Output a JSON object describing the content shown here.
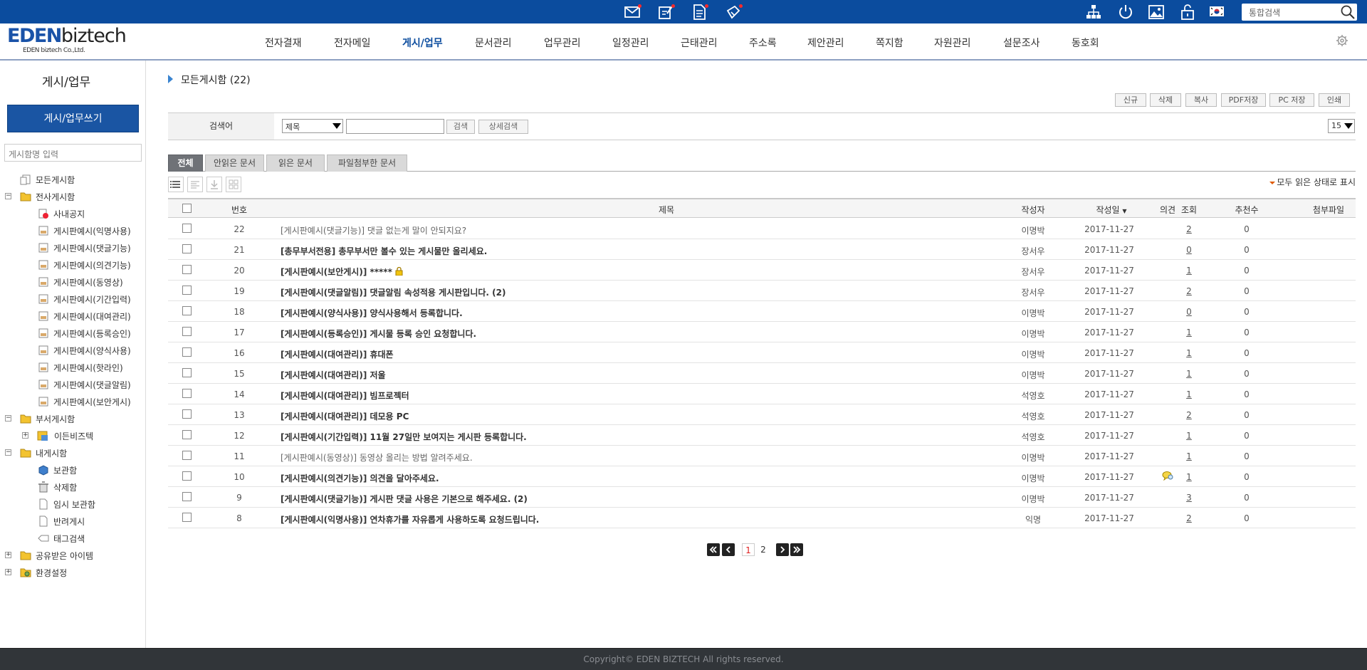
{
  "topbar": {
    "search_placeholder": "통합검색",
    "icons": [
      "mail-icon",
      "approval-icon",
      "document-icon",
      "share-icon",
      "org-chart-icon",
      "power-icon",
      "image-icon",
      "lock-icon",
      "korea-flag-icon",
      "search-icon"
    ]
  },
  "logo": {
    "brand_a": "EDEN",
    "brand_b": "biztech",
    "sub": "EDEN biztech Co.,Ltd."
  },
  "gnb": {
    "items": [
      "전자결재",
      "전자메일",
      "게시/업무",
      "문서관리",
      "업무관리",
      "일정관리",
      "근태관리",
      "주소록",
      "제안관리",
      "쪽지함",
      "자원관리",
      "설문조사",
      "동호회"
    ],
    "active_index": 2
  },
  "sidebar": {
    "title": "게시/업무",
    "write_button": "게시/업무쓰기",
    "board_search_placeholder": "게시함명 입력",
    "tree": {
      "all_boards": "모든게시함",
      "company_boards": "전사게시함",
      "notice": "사내공지",
      "company_children": [
        "게시판예시(익명사용)",
        "게시판예시(댓글기능)",
        "게시판예시(의견기능)",
        "게시판예시(동영상)",
        "게시판예시(기간입력)",
        "게시판예시(대여관리)",
        "게시판예시(등록승인)",
        "게시판예시(양식사용)",
        "게시판예시(핫라인)",
        "게시판예시(댓글알림)",
        "게시판예시(보안게시)"
      ],
      "dept_boards": "부서게시함",
      "dept_child": "이든비즈텍",
      "my_boards": "내게시함",
      "my_children": [
        "보관함",
        "삭제함",
        "임시 보관함",
        "반려게시",
        "태그검색"
      ],
      "shared": "공유받은 아이템",
      "settings": "환경설정"
    }
  },
  "content": {
    "title": "모든게시함 (22)",
    "actions": [
      "신규",
      "삭제",
      "복사",
      "PDF저장",
      "PC 저장",
      "인쇄"
    ],
    "search": {
      "label": "검색어",
      "field_selected": "제목",
      "search_button": "검색",
      "detail_button": "상세검색",
      "page_size": "15"
    },
    "tabs": [
      "전체",
      "안읽은 문서",
      "읽은 문서",
      "파일첨부한 문서"
    ],
    "mark_all_read": "모두 읽은 상태로 표시",
    "columns": {
      "no": "번호",
      "title": "제목",
      "author": "작성자",
      "date": "작성일",
      "opinion": "의견",
      "views": "조회",
      "recommend": "추천수",
      "attachment": "첨부파일"
    },
    "rows": [
      {
        "no": "22",
        "title": "[게시판예시(댓글기능)] 댓글 없는게 말이 안되지요?",
        "bold": false,
        "author": "이명박",
        "date": "2017-11-27",
        "views": "2",
        "rec": "0",
        "lock": false,
        "opinion": false
      },
      {
        "no": "21",
        "title": "[총무부서전용] 총무부서만 볼수 있는 게시물만 올리세요.",
        "bold": true,
        "author": "장서우",
        "date": "2017-11-27",
        "views": "0",
        "rec": "0",
        "lock": false,
        "opinion": false
      },
      {
        "no": "20",
        "title": "[게시판예시(보안게시)] *****",
        "bold": true,
        "author": "장서우",
        "date": "2017-11-27",
        "views": "1",
        "rec": "0",
        "lock": true,
        "opinion": false
      },
      {
        "no": "19",
        "title": "[게시판예시(댓글알림)] 댓글알림 속성적용 게시판입니다. (2)",
        "bold": true,
        "author": "장서우",
        "date": "2017-11-27",
        "views": "2",
        "rec": "0",
        "lock": false,
        "opinion": false
      },
      {
        "no": "18",
        "title": "[게시판예시(양식사용)] 양식사용해서 등록합니다.",
        "bold": true,
        "author": "이명박",
        "date": "2017-11-27",
        "views": "0",
        "rec": "0",
        "lock": false,
        "opinion": false
      },
      {
        "no": "17",
        "title": "[게시판예시(등록승인)] 게시물 등록 승인 요청합니다.",
        "bold": true,
        "author": "이명박",
        "date": "2017-11-27",
        "views": "1",
        "rec": "0",
        "lock": false,
        "opinion": false
      },
      {
        "no": "16",
        "title": "[게시판예시(대여관리)] 휴대폰",
        "bold": true,
        "author": "이명박",
        "date": "2017-11-27",
        "views": "1",
        "rec": "0",
        "lock": false,
        "opinion": false
      },
      {
        "no": "15",
        "title": "[게시판예시(대여관리)] 저울",
        "bold": true,
        "author": "이명박",
        "date": "2017-11-27",
        "views": "1",
        "rec": "0",
        "lock": false,
        "opinion": false
      },
      {
        "no": "14",
        "title": "[게시판예시(대여관리)] 빔프로젝터",
        "bold": true,
        "author": "석영호",
        "date": "2017-11-27",
        "views": "1",
        "rec": "0",
        "lock": false,
        "opinion": false
      },
      {
        "no": "13",
        "title": "[게시판예시(대여관리)] 데모용 PC",
        "bold": true,
        "author": "석영호",
        "date": "2017-11-27",
        "views": "2",
        "rec": "0",
        "lock": false,
        "opinion": false
      },
      {
        "no": "12",
        "title": "[게시판예시(기간입력)] 11월 27일만 보여지는 게시판 등록합니다.",
        "bold": true,
        "author": "석영호",
        "date": "2017-11-27",
        "views": "1",
        "rec": "0",
        "lock": false,
        "opinion": false
      },
      {
        "no": "11",
        "title": "[게시판예시(동영상)] 동영상 올리는 방법 알려주세요.",
        "bold": false,
        "author": "이명박",
        "date": "2017-11-27",
        "views": "1",
        "rec": "0",
        "lock": false,
        "opinion": false
      },
      {
        "no": "10",
        "title": "[게시판예시(의견기능)] 의견을 달아주세요.",
        "bold": true,
        "author": "이명박",
        "date": "2017-11-27",
        "views": "1",
        "rec": "0",
        "lock": false,
        "opinion": true
      },
      {
        "no": "9",
        "title": "[게시판예시(댓글기능)] 게시판 댓글 사용은 기본으로 해주세요. (2)",
        "bold": true,
        "author": "이명박",
        "date": "2017-11-27",
        "views": "3",
        "rec": "0",
        "lock": false,
        "opinion": false
      },
      {
        "no": "8",
        "title": "[게시판예시(익명사용)] 연차휴가를 자유롭게 사용하도록 요청드립니다.",
        "bold": true,
        "author": "익명",
        "date": "2017-11-27",
        "views": "2",
        "rec": "0",
        "lock": false,
        "opinion": false
      }
    ],
    "pagination": {
      "pages": [
        "1",
        "2"
      ],
      "current": "1"
    }
  },
  "footer": {
    "copyright": "Copyright© EDEN BIZTECH All rights reserved."
  },
  "colors": {
    "topbar": "#0b4c9e",
    "accent": "#1a55a3",
    "active_nav": "#0b4c9e",
    "footer": "#313539"
  }
}
